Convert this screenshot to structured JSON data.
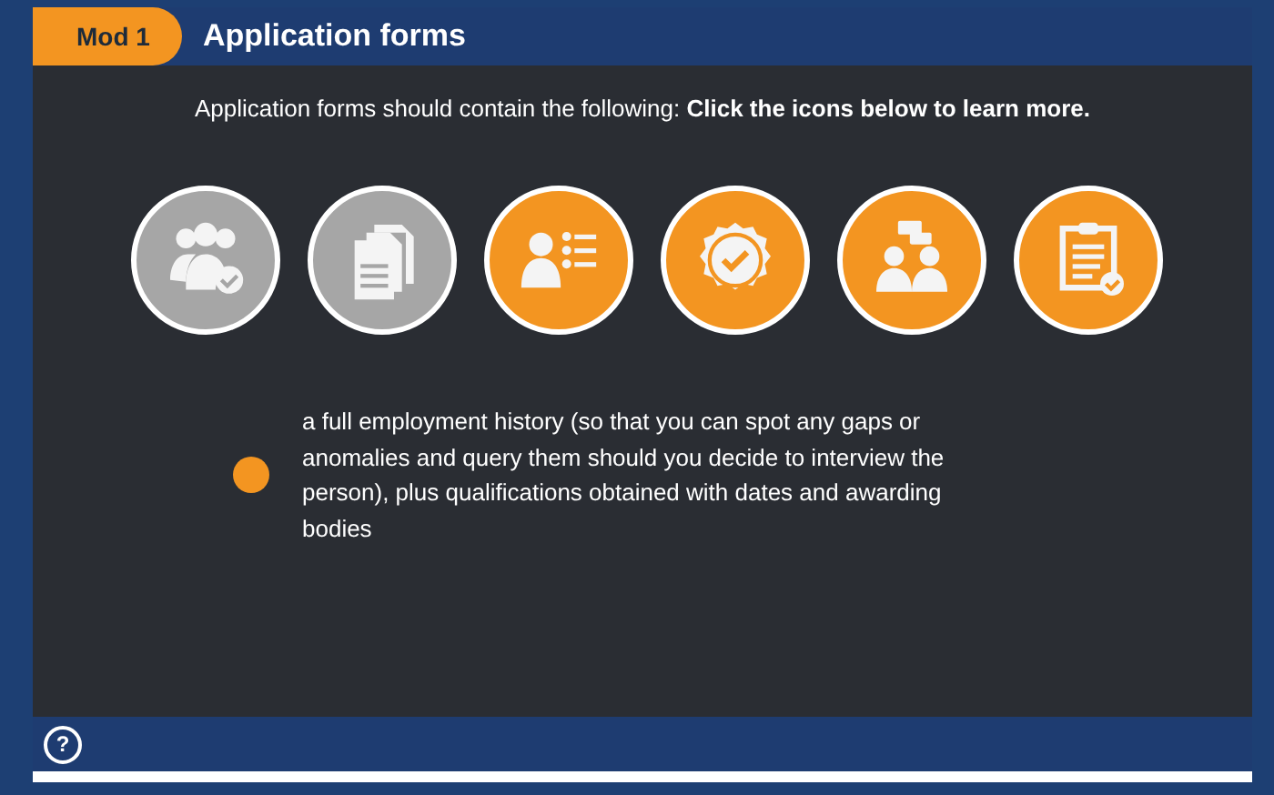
{
  "header": {
    "module_badge": "Mod 1",
    "title": "Application forms"
  },
  "intro": "Application forms should contain the following: **Click the icons below to learn more.**",
  "icons": [
    {
      "kind": "people-check",
      "visited": true
    },
    {
      "kind": "documents",
      "visited": true
    },
    {
      "kind": "profile-list",
      "visited": false
    },
    {
      "kind": "badge-check",
      "visited": false
    },
    {
      "kind": "people-chat",
      "visited": false
    },
    {
      "kind": "clipboard-check",
      "visited": false
    }
  ],
  "detail": {
    "text": "a full employment history (so that you can spot any gaps or anomalies and query them should you decide to interview the person), plus qualifications obtained with dates and awarding bodies"
  },
  "footer": {
    "help_button": "?"
  }
}
